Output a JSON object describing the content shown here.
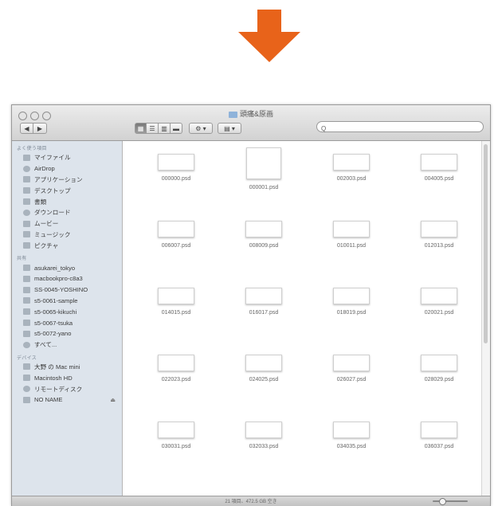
{
  "window": {
    "title": "頭痛&原画",
    "search_placeholder": "Q",
    "status_text": "21 項目、472.5 GB 空き"
  },
  "toolbar": {
    "back_label": "◀",
    "forward_label": "▶",
    "view_icon_label": "▦",
    "view_list_label": "☰",
    "view_column_label": "▥",
    "view_coverflow_label": "▬",
    "action_label": "⚙ ▾",
    "arrange_label": "▤ ▾"
  },
  "sidebar": {
    "favorites_header": "よく使う項目",
    "favorites": [
      {
        "label": "マイファイル",
        "icon": "all-files-icon"
      },
      {
        "label": "AirDrop",
        "icon": "airdrop-icon"
      },
      {
        "label": "アプリケーション",
        "icon": "applications-icon"
      },
      {
        "label": "デスクトップ",
        "icon": "desktop-icon"
      },
      {
        "label": "書類",
        "icon": "documents-icon"
      },
      {
        "label": "ダウンロード",
        "icon": "downloads-icon"
      },
      {
        "label": "ムービー",
        "icon": "movies-icon"
      },
      {
        "label": "ミュージック",
        "icon": "music-icon"
      },
      {
        "label": "ピクチャ",
        "icon": "pictures-icon"
      }
    ],
    "shared_header": "共有",
    "shared": [
      {
        "label": "asukarei_tokyo",
        "icon": "computer-icon"
      },
      {
        "label": "macbookpro-c8a3",
        "icon": "laptop-icon"
      },
      {
        "label": "SS-0045-YOSHINO",
        "icon": "server-icon"
      },
      {
        "label": "s5-0061-sample",
        "icon": "computer-icon"
      },
      {
        "label": "s5-0065-kikuchi",
        "icon": "computer-icon"
      },
      {
        "label": "s5-0067-tsuka",
        "icon": "computer-icon"
      },
      {
        "label": "s5-0072-yano",
        "icon": "computer-icon"
      },
      {
        "label": "すべて...",
        "icon": "network-icon"
      }
    ],
    "devices_header": "デバイス",
    "devices": [
      {
        "label": "大野 の Mac mini",
        "icon": "mac-mini-icon"
      },
      {
        "label": "Macintosh HD",
        "icon": "hard-drive-icon"
      },
      {
        "label": "リモートディスク",
        "icon": "remote-disc-icon"
      },
      {
        "label": "NO NAME",
        "icon": "usb-drive-icon",
        "eject": "⏏"
      }
    ]
  },
  "files": [
    "000000.psd",
    "000001.psd",
    "002003.psd",
    "004005.psd",
    "006007.psd",
    "008009.psd",
    "010011.psd",
    "012013.psd",
    "014015.psd",
    "016017.psd",
    "018019.psd",
    "020021.psd",
    "022023.psd",
    "024025.psd",
    "026027.psd",
    "028029.psd",
    "030031.psd",
    "032033.psd",
    "034035.psd",
    "036037.psd"
  ],
  "colors": {
    "arrow": "#e8631a",
    "sidebar": "#dde4ec"
  }
}
